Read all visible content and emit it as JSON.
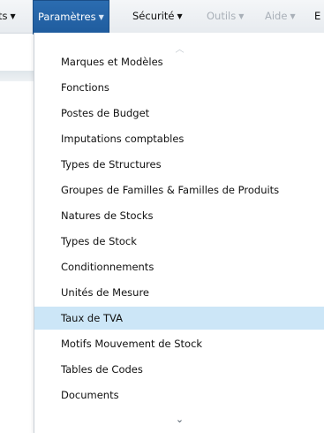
{
  "menubar": {
    "partial_left": "ts",
    "parametres": "Paramètres",
    "securite": "Sécurité",
    "outils": "Outils",
    "aide": "Aide",
    "partial_right": "E"
  },
  "dropdown": {
    "items": [
      "Marques et Modèles",
      "Fonctions",
      "Postes de Budget",
      "Imputations comptables",
      "Types de Structures",
      "Groupes de Familles & Familles de Produits",
      "Natures de Stocks",
      "Types de Stock",
      "Conditionnements",
      "Unités de Mesure",
      "Taux de TVA",
      "Motifs Mouvement de Stock",
      "Tables de Codes",
      "Documents"
    ],
    "highlighted_item": "Taux de TVA",
    "scroll_up_icon": "chevron-up-icon",
    "scroll_down_icon": "chevron-down-icon"
  },
  "colors": {
    "active_menu": "#1f5c9e",
    "hover_item": "#cce6f7",
    "disabled_text": "#a9b0b8"
  }
}
